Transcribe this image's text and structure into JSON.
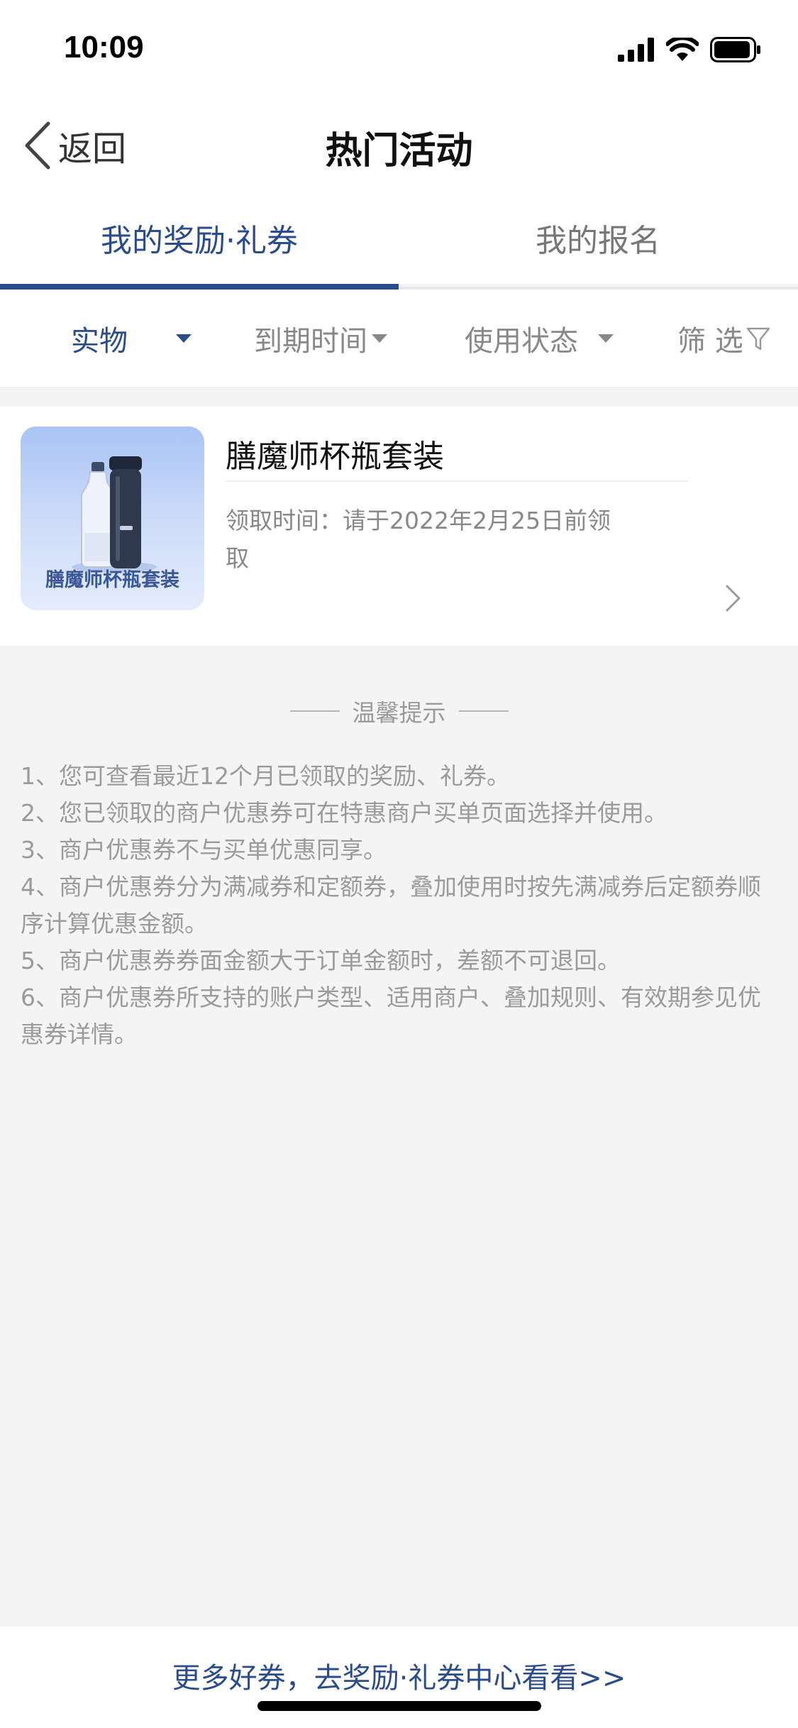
{
  "status_bar": {
    "time": "10:09"
  },
  "nav": {
    "back_label": "返回",
    "title": "热门活动"
  },
  "tabs": [
    {
      "label": "我的奖励·礼券",
      "active": true
    },
    {
      "label": "我的报名",
      "active": false
    }
  ],
  "filters": {
    "category": "实物",
    "expiry": "到期时间",
    "status": "使用状态",
    "filter": "筛 选"
  },
  "reward_item": {
    "title": "膳魔师杯瓶套装",
    "image_label": "膳魔师杯瓶套装",
    "claim_time": "领取时间：请于2022年2月25日前领取"
  },
  "tips": {
    "heading": "温馨提示",
    "items": [
      "1、您可查看最近12个月已领取的奖励、礼券。",
      "2、您已领取的商户优惠券可在特惠商户买单页面选择并使用。",
      "3、商户优惠券不与买单优惠同享。",
      "4、商户优惠券分为满减券和定额券，叠加使用时按先满减券后定额券顺序计算优惠金额。",
      "5、商户优惠券券面金额大于订单金额时，差额不可退回。",
      "6、商户优惠券所支持的账户类型、适用商户、叠加规则、有效期参见优惠券详情。"
    ]
  },
  "bottom_link": "更多好券，去奖励·礼券中心看看>>",
  "colors": {
    "accent": "#2b4c8c",
    "background": "#f4f4f5"
  }
}
